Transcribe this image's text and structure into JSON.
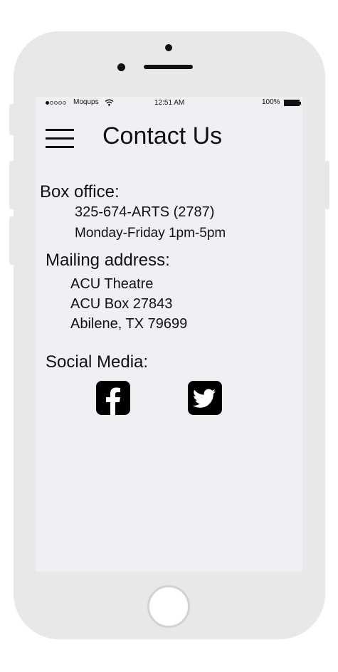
{
  "status_bar": {
    "carrier": "Moqups",
    "time": "12:51 AM",
    "battery": "100%"
  },
  "header": {
    "title": "Contact Us",
    "menu_icon": "hamburger-menu-icon"
  },
  "box_office": {
    "heading": "Box office:",
    "phone": "325-674-ARTS (2787)",
    "hours": "Monday-Friday 1pm-5pm"
  },
  "mailing": {
    "heading": "Mailing address:",
    "line1": "ACU Theatre",
    "line2": "ACU Box 27843",
    "line3": "Abilene, TX 79699"
  },
  "social": {
    "heading": "Social Media:",
    "items": [
      {
        "icon": "facebook-icon"
      },
      {
        "icon": "twitter-icon"
      }
    ]
  }
}
